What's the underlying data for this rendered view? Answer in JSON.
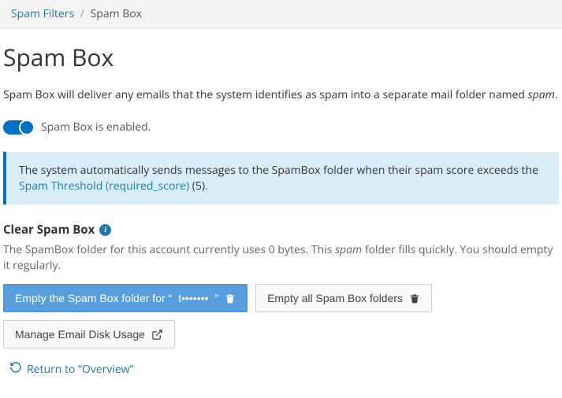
{
  "breadcrumb": {
    "parent": "Spam Filters",
    "current": "Spam Box"
  },
  "page_title": "Spam Box",
  "description_prefix": "Spam Box will deliver any emails that the system identifies as spam into a separate mail folder named ",
  "description_folder": "spam",
  "description_suffix": ".",
  "toggle": {
    "label": "Spam Box is enabled."
  },
  "callout": {
    "text_before_link": "The system automatically sends messages to the SpamBox folder when their spam score exceeds the ",
    "link_text": "Spam Threshold (required_score)",
    "threshold_value": "5",
    "text_after_link_prefix": " (",
    "text_after_link_suffix": ")."
  },
  "clear_section": {
    "title": "Clear Spam Box",
    "usage_prefix": "The SpamBox folder for this account currently uses ",
    "usage_bytes": "0 bytes",
    "usage_mid": ". This ",
    "usage_folder": "spam",
    "usage_suffix": " folder fills quickly. You should empty it regularly."
  },
  "buttons": {
    "empty_this_prefix": "Empty the Spam Box folder for “",
    "empty_this_account": "t•••••••",
    "empty_this_suffix": "”",
    "empty_all": "Empty all Spam Box folders",
    "manage_disk": "Manage Email Disk Usage"
  },
  "return_link": "Return to “Overview”"
}
